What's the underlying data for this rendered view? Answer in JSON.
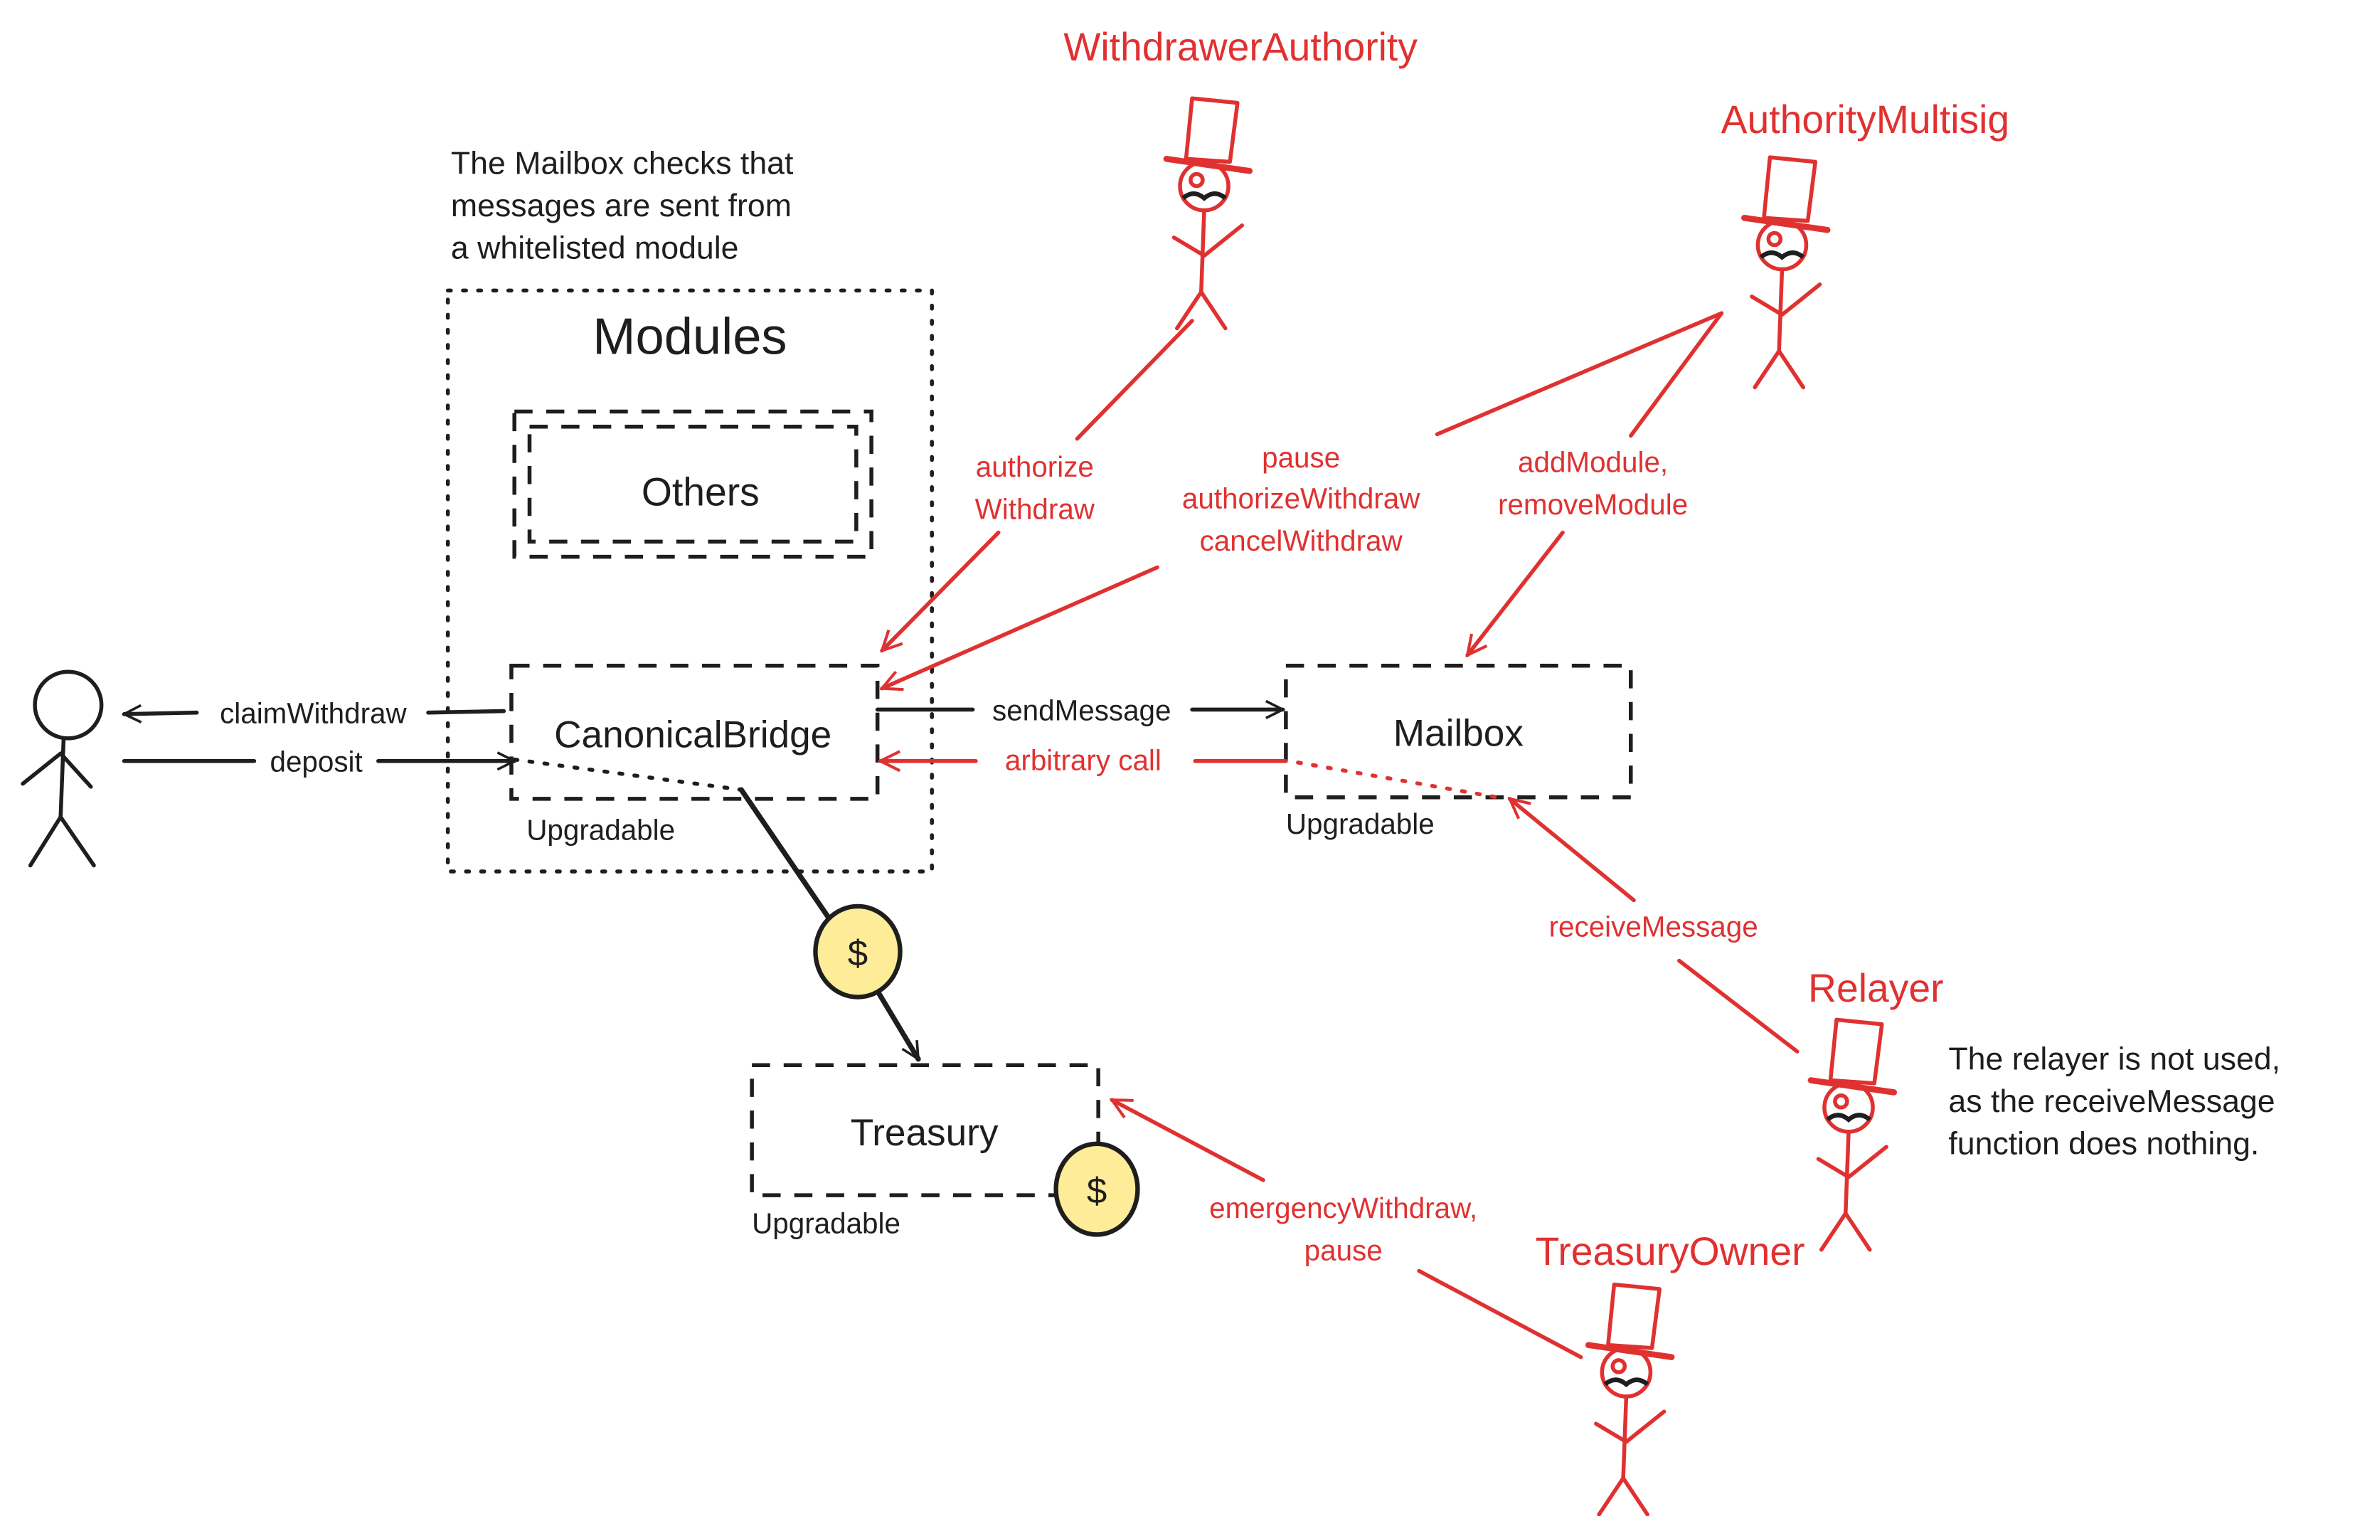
{
  "colors": {
    "ink": "#1e1e1e",
    "accent_red": "#e03131",
    "coin_fill": "#ffec99"
  },
  "notes": {
    "mailbox_note": [
      "The Mailbox checks that",
      "messages are sent from",
      "a whitelisted module"
    ],
    "relayer_note": [
      "The relayer is not used,",
      "as the receiveMessage",
      "function does nothing."
    ]
  },
  "groups": {
    "modules_title": "Modules"
  },
  "boxes": {
    "others": "Others",
    "canonical_bridge": "CanonicalBridge",
    "mailbox": "Mailbox",
    "treasury": "Treasury",
    "upgradable": "Upgradable"
  },
  "actors": {
    "withdrawer_authority": "WithdrawerAuthority",
    "authority_multisig": "AuthorityMultisig",
    "relayer": "Relayer",
    "treasury_owner": "TreasuryOwner"
  },
  "edges": {
    "claim_withdraw": "claimWithdraw",
    "deposit": "deposit",
    "send_message": "sendMessage",
    "arbitrary_call": "arbitrary call",
    "authorize_withdraw": [
      "authorize",
      "Withdraw"
    ],
    "multisig_bridge": [
      "pause",
      "authorizeWithdraw",
      "cancelWithdraw"
    ],
    "multisig_mailbox": [
      "addModule,",
      "removeModule"
    ],
    "receive_message": "receiveMessage",
    "treasury_owner_calls": [
      "emergencyWithdraw,",
      "pause"
    ]
  },
  "icons": {
    "coin": "dollar-coin-icon",
    "user": "stick-figure-icon",
    "actor": "top-hat-figure-icon"
  },
  "coin_symbol": "$"
}
